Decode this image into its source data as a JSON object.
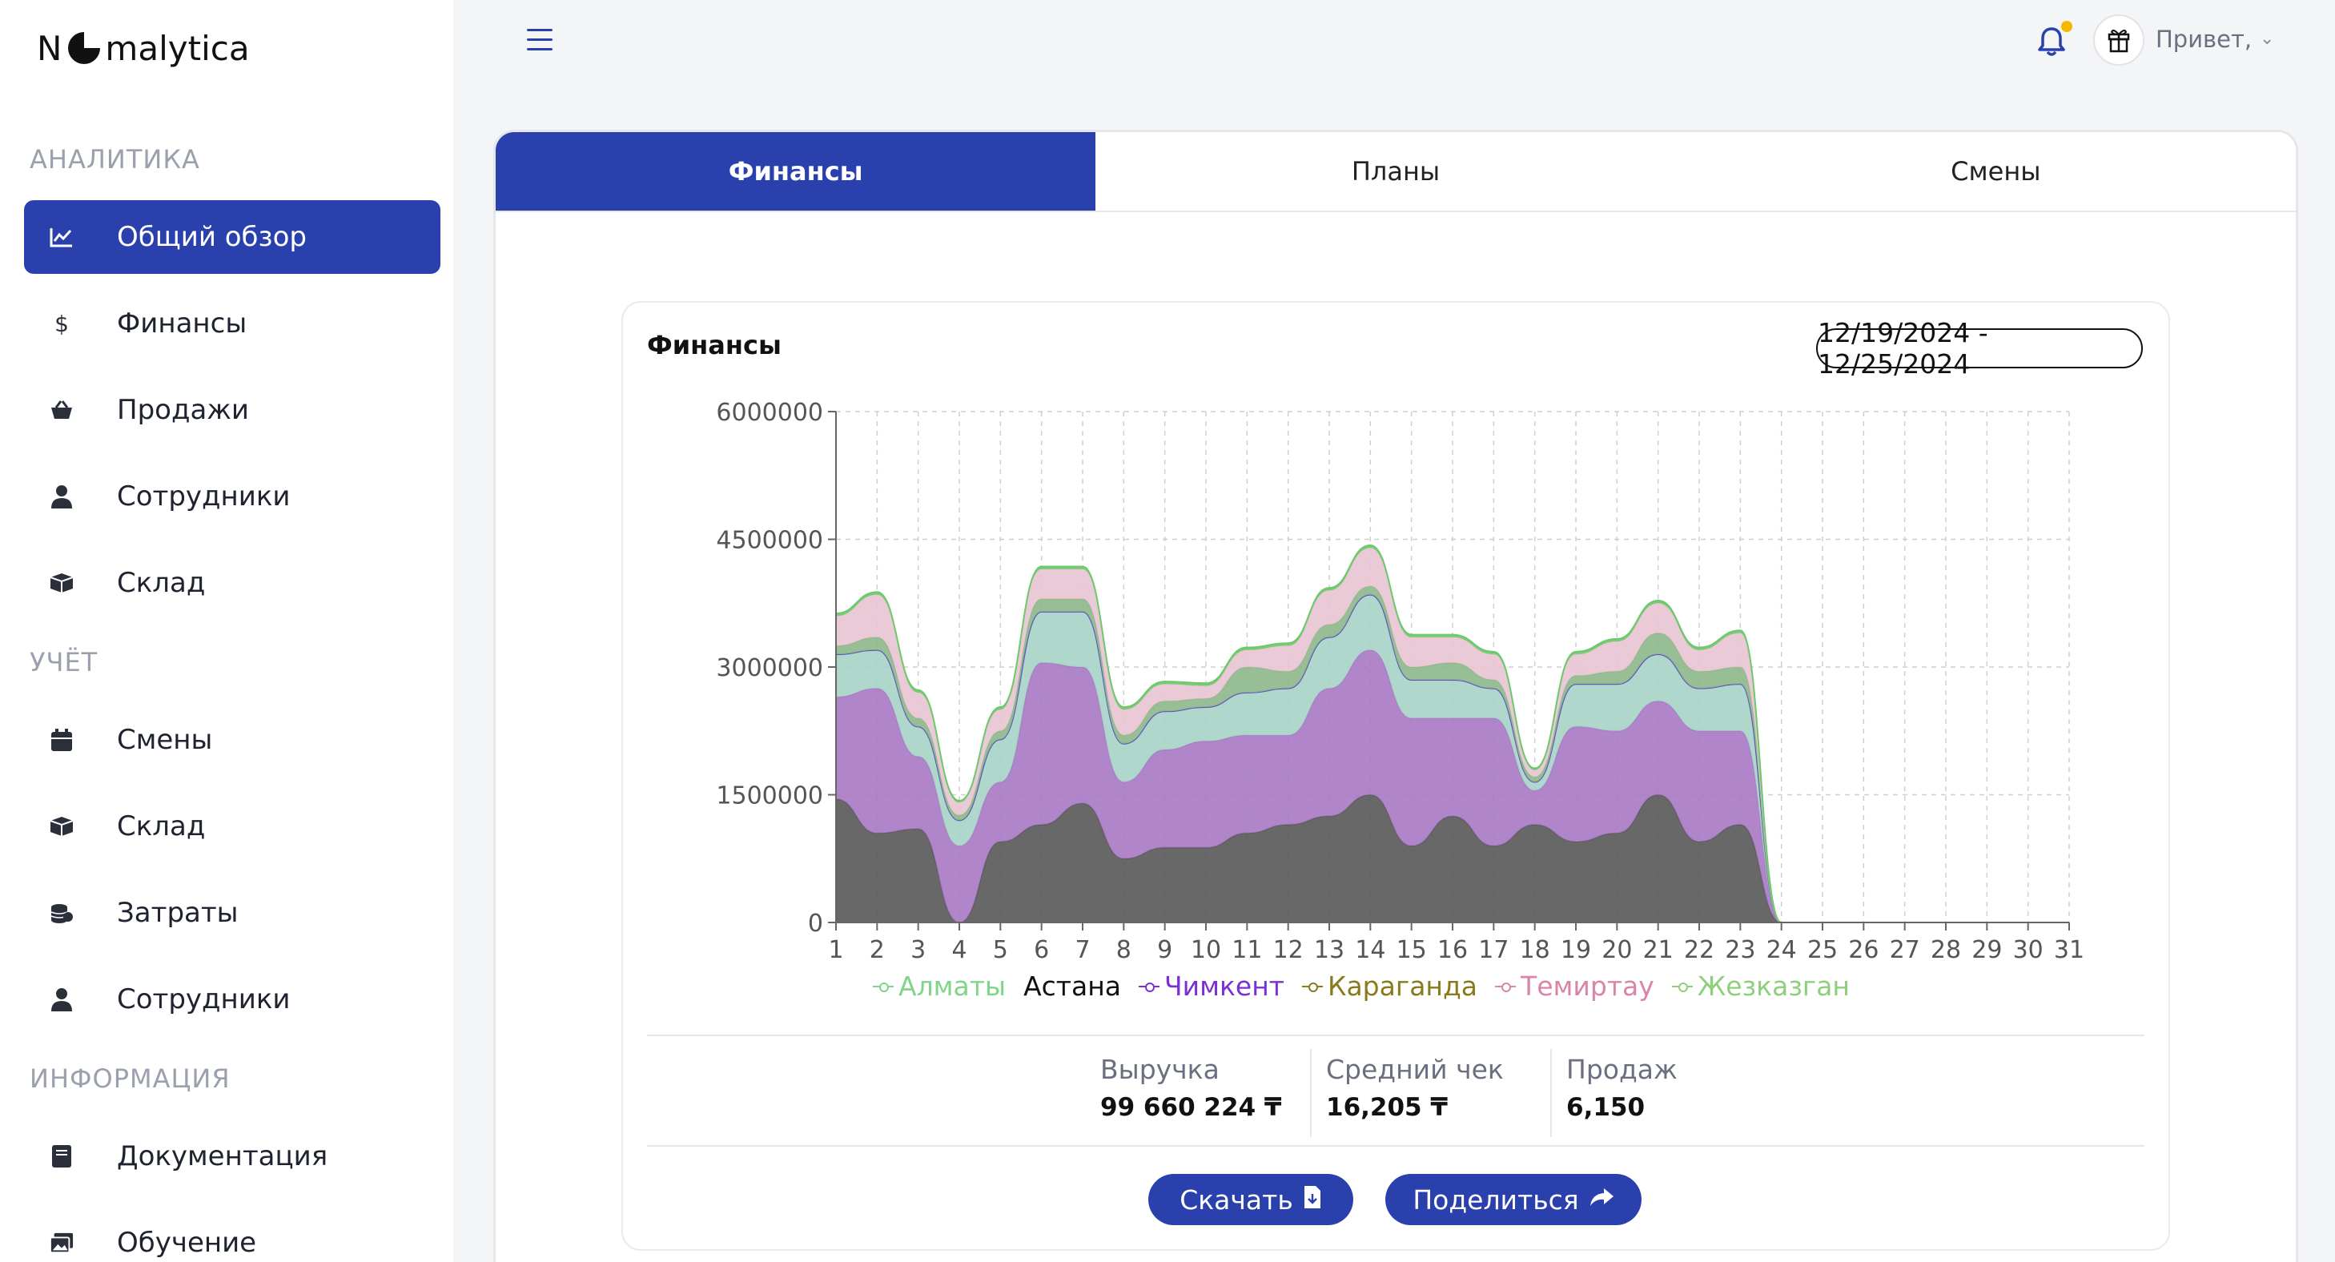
{
  "brand": {
    "prefix": "N",
    "suffix": "malytica"
  },
  "sidebar": {
    "sections": [
      {
        "title": "АНАЛИТИКА"
      },
      {
        "title": "УЧЁТ"
      },
      {
        "title": "ИНФОРМАЦИЯ"
      }
    ],
    "items": [
      {
        "label": "Общий обзор",
        "icon": "chart-line-icon",
        "active": true
      },
      {
        "label": "Финансы",
        "icon": "dollar-icon"
      },
      {
        "label": "Продажи",
        "icon": "basket-icon"
      },
      {
        "label": "Сотрудники",
        "icon": "user-tie-icon"
      },
      {
        "label": "Склад",
        "icon": "box-icon"
      },
      {
        "label": "Смены",
        "icon": "calendar-icon"
      },
      {
        "label": "Склад",
        "icon": "box-icon"
      },
      {
        "label": "Затраты",
        "icon": "coins-icon"
      },
      {
        "label": "Сотрудники",
        "icon": "user-tie-icon"
      },
      {
        "label": "Документация",
        "icon": "book-icon"
      },
      {
        "label": "Обучение",
        "icon": "images-icon"
      }
    ]
  },
  "header": {
    "greeting": "Привет,",
    "notification_dot_color": "#f5b800"
  },
  "tabs": [
    {
      "label": "Финансы",
      "active": true
    },
    {
      "label": "Планы"
    },
    {
      "label": "Смены"
    }
  ],
  "card": {
    "title": "Финансы",
    "date_range": "12/19/2024 - 12/25/2024",
    "stats": [
      {
        "label": "Выручка",
        "value": "99 660 224 ₸"
      },
      {
        "label": "Средний чек",
        "value": "16,205 ₸"
      },
      {
        "label": "Продаж",
        "value": "6,150"
      }
    ],
    "buttons": {
      "download": "Скачать",
      "share": "Поделиться"
    }
  },
  "chart_data": {
    "type": "area",
    "stacked": true,
    "x": [
      1,
      2,
      3,
      4,
      5,
      6,
      7,
      8,
      9,
      10,
      11,
      12,
      13,
      14,
      15,
      16,
      17,
      18,
      19,
      20,
      21,
      22,
      23,
      24,
      25,
      26,
      27,
      28,
      29,
      30,
      31
    ],
    "ylim": [
      0,
      6000000
    ],
    "yticks": [
      "6000000",
      "4500000",
      "3000000",
      "1500000",
      "0"
    ],
    "grid": true,
    "legend_position": "bottom",
    "series": [
      {
        "name": "Астана",
        "color": "#5b5b5b",
        "values": [
          1450000,
          1050000,
          1100000,
          0,
          950000,
          1150000,
          1400000,
          750000,
          880000,
          880000,
          1050000,
          1150000,
          1250000,
          1500000,
          900000,
          1250000,
          900000,
          1150000,
          950000,
          1050000,
          1500000,
          950000,
          1150000,
          0,
          0,
          0,
          0,
          0,
          0,
          0,
          0
        ]
      },
      {
        "name": "Чимкент",
        "color": "#a97bc4",
        "values": [
          1200000,
          1700000,
          850000,
          900000,
          700000,
          1900000,
          1600000,
          900000,
          1150000,
          1250000,
          1150000,
          1050000,
          1500000,
          1700000,
          1500000,
          1150000,
          1500000,
          400000,
          1350000,
          1200000,
          1100000,
          1300000,
          1100000,
          0,
          0,
          0,
          0,
          0,
          0,
          0,
          0
        ]
      },
      {
        "name": "Алматы",
        "color": "#a8d4c8",
        "values": [
          500000,
          450000,
          350000,
          300000,
          500000,
          600000,
          650000,
          450000,
          450000,
          400000,
          500000,
          550000,
          600000,
          650000,
          450000,
          450000,
          350000,
          100000,
          500000,
          550000,
          550000,
          500000,
          550000,
          0,
          0,
          0,
          0,
          0,
          0,
          0,
          0
        ]
      },
      {
        "name": "Караганда",
        "color": "#8fb88c",
        "values": [
          100000,
          150000,
          100000,
          60000,
          100000,
          150000,
          150000,
          100000,
          120000,
          100000,
          300000,
          200000,
          150000,
          100000,
          150000,
          200000,
          100000,
          60000,
          100000,
          150000,
          250000,
          200000,
          200000,
          0,
          0,
          0,
          0,
          0,
          0,
          0,
          0
        ]
      },
      {
        "name": "Темиртау",
        "color": "#e8c6d3",
        "values": [
          350000,
          500000,
          300000,
          150000,
          250000,
          350000,
          350000,
          300000,
          200000,
          150000,
          200000,
          300000,
          400000,
          450000,
          350000,
          300000,
          300000,
          80000,
          250000,
          350000,
          350000,
          250000,
          400000,
          0,
          0,
          0,
          0,
          0,
          0,
          0,
          0
        ]
      },
      {
        "name": "Жезказган",
        "color": "#6cc96a",
        "values": [
          30000,
          30000,
          30000,
          20000,
          30000,
          30000,
          30000,
          30000,
          30000,
          30000,
          30000,
          30000,
          30000,
          30000,
          30000,
          30000,
          30000,
          20000,
          30000,
          30000,
          30000,
          30000,
          30000,
          0,
          0,
          0,
          0,
          0,
          0,
          0,
          0
        ]
      }
    ],
    "legend": [
      {
        "name": "Алматы",
        "color": "#7fd58a",
        "marker": true
      },
      {
        "name": "Астана",
        "color": "#111111",
        "marker": false
      },
      {
        "name": "Чимкент",
        "color": "#7b2fd6",
        "marker": true
      },
      {
        "name": "Караганда",
        "color": "#8a7a1c",
        "marker": true
      },
      {
        "name": "Темиртау",
        "color": "#d985a9",
        "marker": true
      },
      {
        "name": "Жезказган",
        "color": "#8fcf7c",
        "marker": true
      }
    ]
  }
}
